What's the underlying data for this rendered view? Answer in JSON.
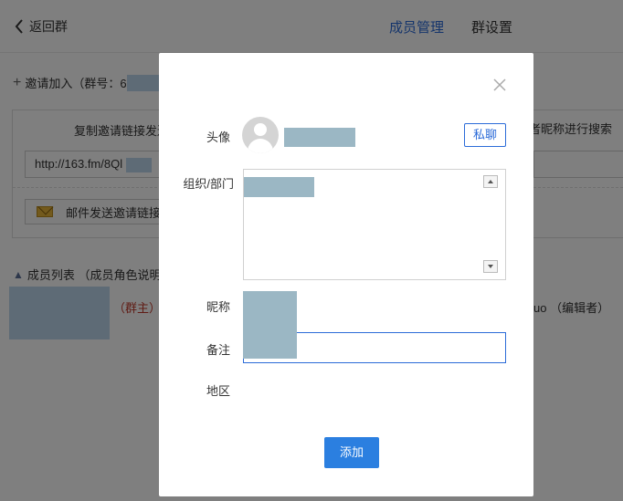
{
  "header": {
    "back_label": "返回群",
    "tabs": [
      {
        "label": "成员管理",
        "active": true
      },
      {
        "label": "群设置",
        "active": false
      }
    ]
  },
  "invite": {
    "label": "邀请加入（群号：6",
    "copy_title": "复制邀请链接发送",
    "link_value": "http://163.fm/8Ql",
    "email_label": "邮件发送邀请链接",
    "search_hint": "或者昵称进行搜索"
  },
  "members": {
    "title": "成员列表 （成员角色说明）",
    "owner_tag": "（群主）",
    "editor_tag": "uo （编辑者）"
  },
  "modal": {
    "avatar_label": "头像",
    "chat_button": "私聊",
    "org_label": "组织/部门",
    "nickname_label": "昵称",
    "note_label": "备注",
    "region_label": "地区",
    "add_button": "添加",
    "note_value": ""
  },
  "colors": {
    "accent": "#2b6bd8",
    "primary_button": "#2b7fe0",
    "owner_red": "#c0392b",
    "redaction": "#9bb7c4"
  }
}
